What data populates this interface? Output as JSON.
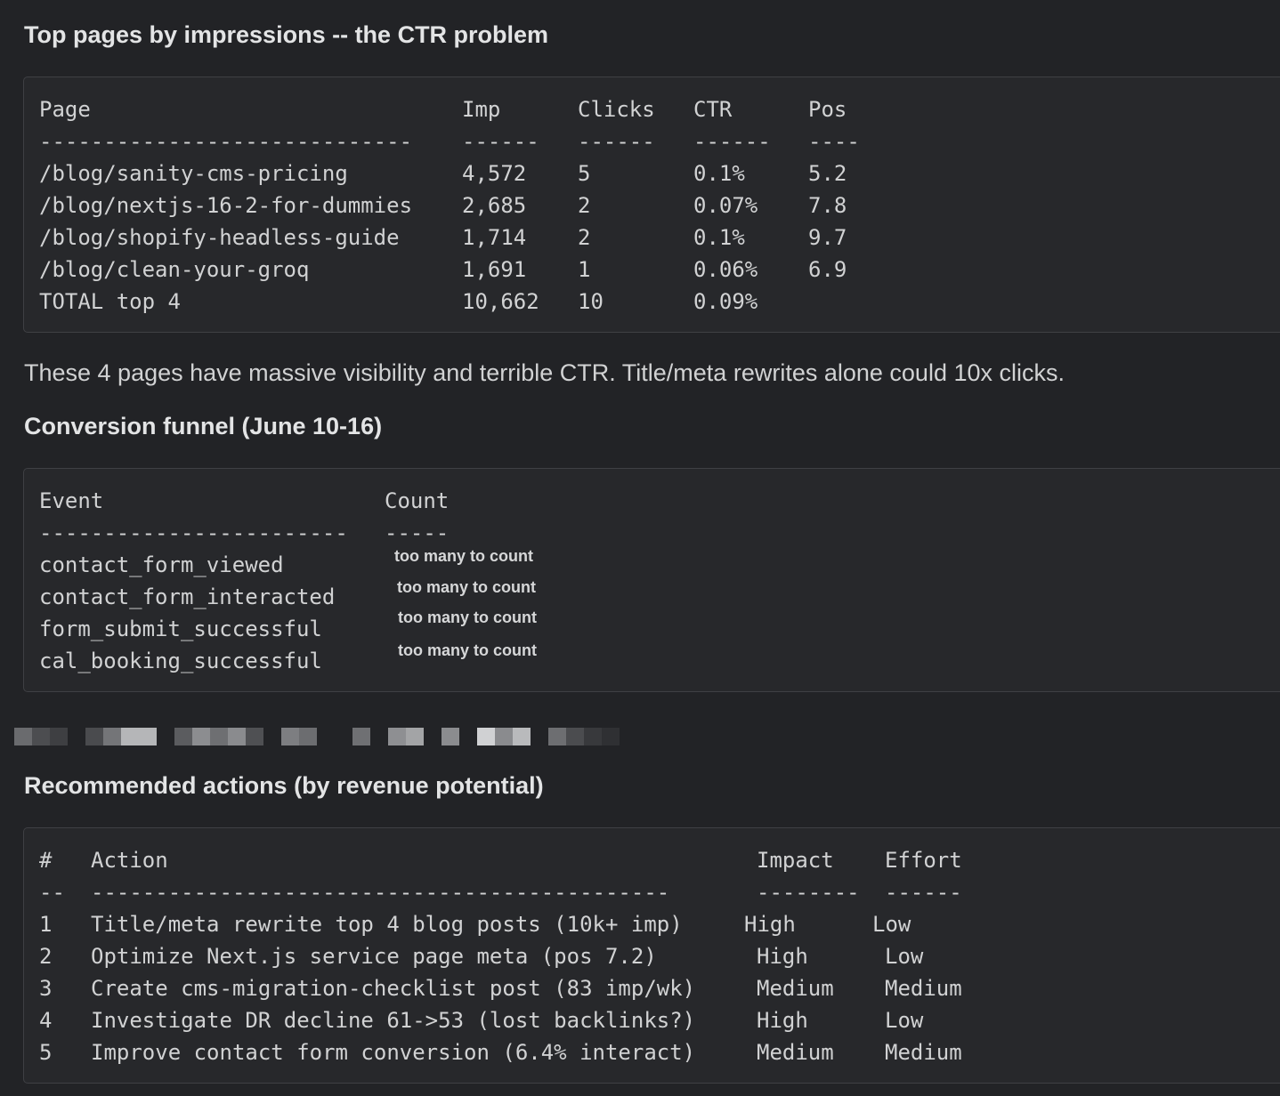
{
  "section1": {
    "heading": "Top pages by impressions -- the CTR problem",
    "table": {
      "headers": [
        "Page",
        "Imp",
        "Clicks",
        "CTR",
        "Pos"
      ],
      "separators": [
        "-----------------------------",
        "------",
        "------",
        "------",
        "----"
      ],
      "rows": [
        [
          "/blog/sanity-cms-pricing",
          "4,572",
          "5",
          "0.1%",
          "5.2"
        ],
        [
          "/blog/nextjs-16-2-for-dummies",
          "2,685",
          "2",
          "0.07%",
          "7.8"
        ],
        [
          "/blog/shopify-headless-guide",
          "1,714",
          "2",
          "0.1%",
          "9.7"
        ],
        [
          "/blog/clean-your-groq",
          "1,691",
          "1",
          "0.06%",
          "6.9"
        ],
        [
          "TOTAL top 4",
          "10,662",
          "10",
          "0.09%",
          ""
        ]
      ]
    },
    "note": "These 4 pages have massive visibility and terrible CTR. Title/meta rewrites alone could 10x clicks."
  },
  "section2": {
    "heading": "Conversion funnel (June 10-16)",
    "table": {
      "headers": [
        "Event",
        "Count"
      ],
      "separators": [
        "------------------------",
        "-----"
      ],
      "rows": [
        [
          "contact_form_viewed",
          "too many to count"
        ],
        [
          "contact_form_interacted",
          "too many to count"
        ],
        [
          "form_submit_successful",
          "too many to count"
        ],
        [
          "cal_booking_successful",
          "too many to count"
        ]
      ]
    }
  },
  "section3": {
    "heading": "Recommended actions (by revenue potential)",
    "table": {
      "headers": [
        "#",
        "Action",
        "Impact",
        "Effort"
      ],
      "separators": [
        "--",
        "---------------------------------------------",
        "--------",
        "------"
      ],
      "rows": [
        [
          "1",
          "Title/meta rewrite top 4 blog posts (10k+ imp)",
          "High",
          "Low"
        ],
        [
          "2",
          "Optimize Next.js service page meta (pos 7.2)",
          "High",
          "Low"
        ],
        [
          "3",
          "Create cms-migration-checklist post (83 imp/wk)",
          "Medium",
          "Medium"
        ],
        [
          "4",
          "Investigate DR decline 61->53 (lost backlinks?)",
          "High",
          "Low"
        ],
        [
          "5",
          "Improve contact form conversion (6.4% interact)",
          "Medium",
          "Medium"
        ]
      ]
    }
  },
  "colors": {
    "background": "#222326",
    "code_background": "#27282b",
    "code_border": "#3f4044",
    "text": "#d1d2d3"
  }
}
